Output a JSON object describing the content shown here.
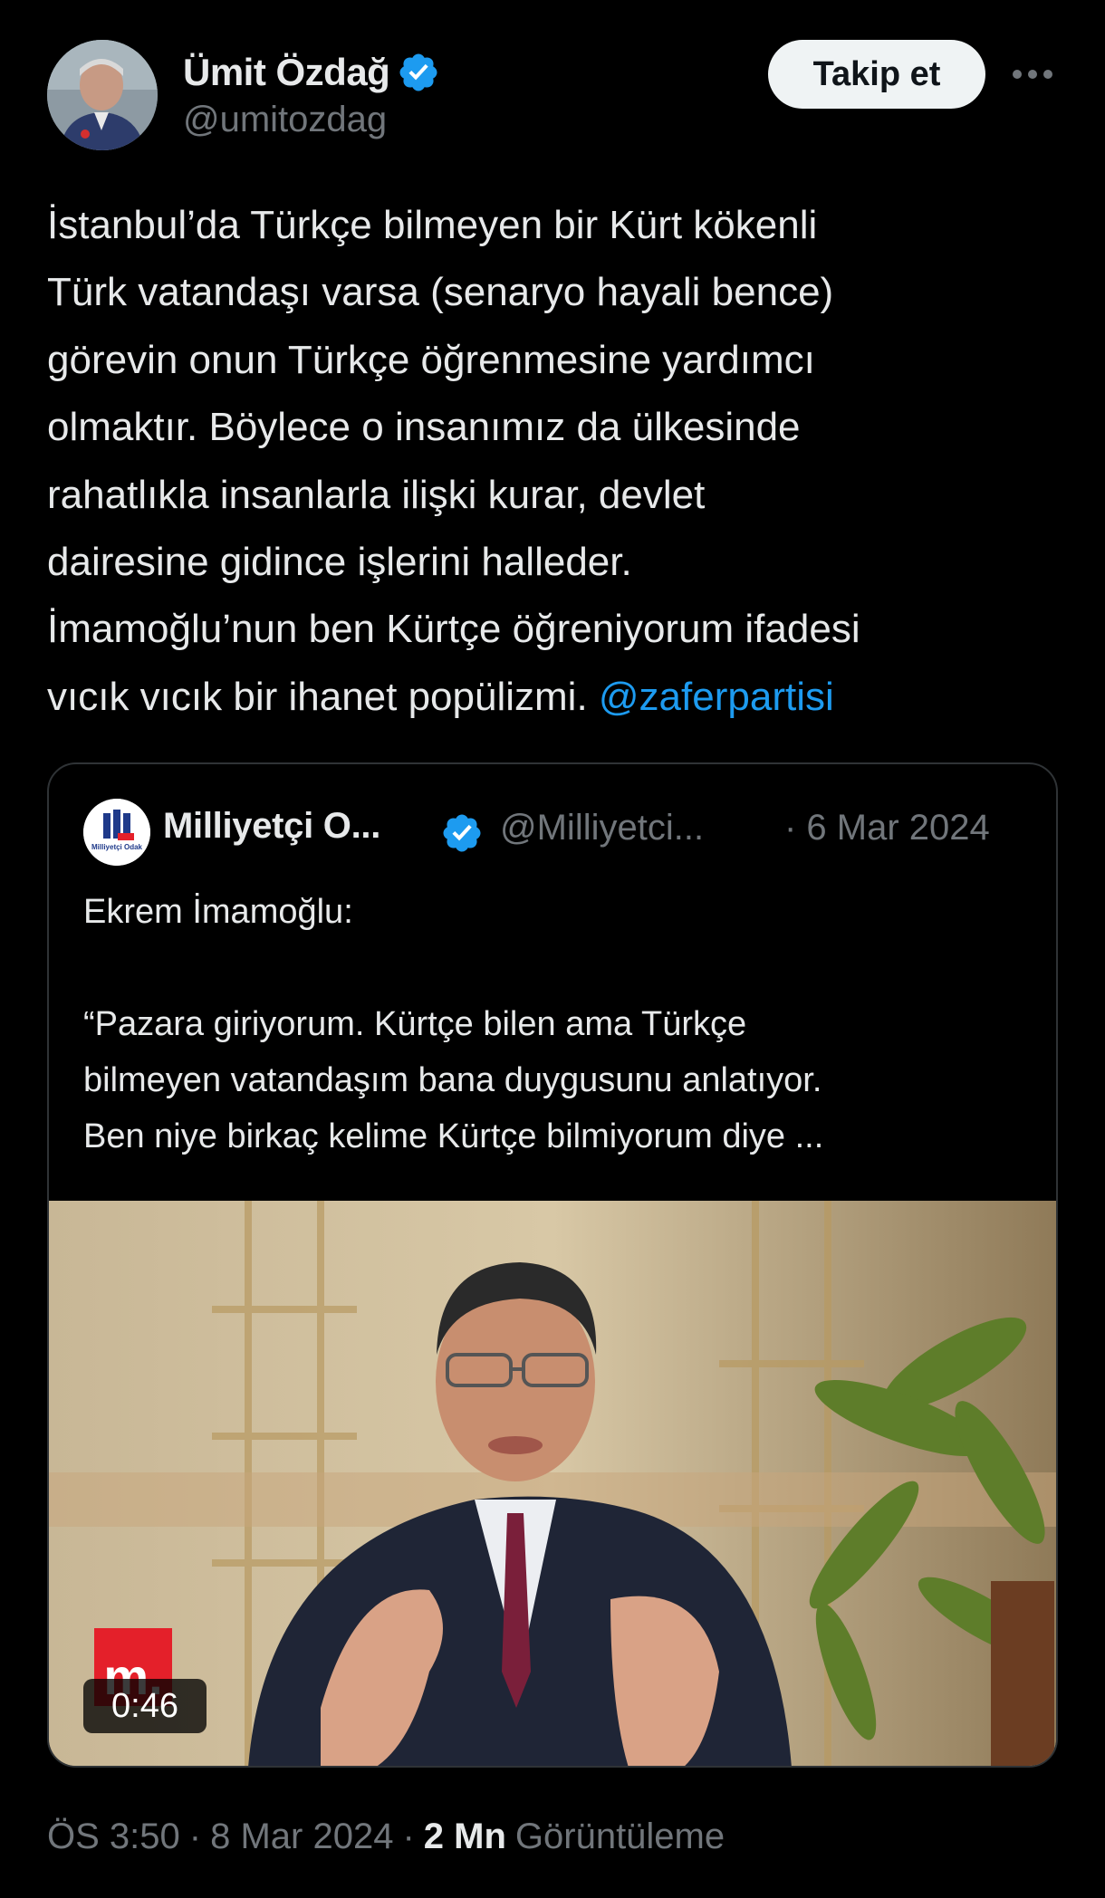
{
  "author": {
    "name": "Ümit Özdağ",
    "handle": "@umitozdag",
    "verified": true,
    "avatar_icon": "profile-photo"
  },
  "actions": {
    "follow_label": "Takip et",
    "more_icon": "more-dots-icon"
  },
  "tweet": {
    "text": "İstanbul’da Türkçe bilmeyen bir Kürt kökenli\nTürk vatandaşı varsa (senaryo hayali bence)\ngörevin onun Türkçe öğrenmesine yardımcı\nolmaktır. Böylece o insanımız da ülkesinde\nrahatlıkla insanlarla ilişki kurar, devlet\ndairesine gidince işlerini halleder.\nİmamoğlu’nun ben Kürtçe öğreniyorum ifadesi\nvıcık vıcık bir ihanet popülizmi. ",
    "mention": "@zaferpartisi"
  },
  "quoted": {
    "name": "Milliyetçi O...",
    "handle": "@Milliyetci...",
    "date": "· 6 Mar 2024",
    "text": "Ekrem İmamoğlu:\n\n“Pazara giriyorum. Kürtçe bilen ama Türkçe\nbilmeyen vatandaşım bana duygusunu anlatıyor.\nBen niye birkaç kelime Kürtçe bilmiyorum diye ...",
    "avatar_text": "Milliyetçi Odak",
    "media": {
      "duration": "0:46",
      "logo": "m."
    }
  },
  "meta": {
    "time": "ÖS 3:50",
    "date": "8 Mar 2024",
    "views_count": "2 Mn",
    "views_label": "Görüntüleme",
    "sep": "·"
  },
  "colors": {
    "background": "#000000",
    "text": "#e7e9ea",
    "muted": "#71767b",
    "link": "#1d9bf0",
    "verified": "#1d9bf0",
    "border": "#2f3336"
  }
}
